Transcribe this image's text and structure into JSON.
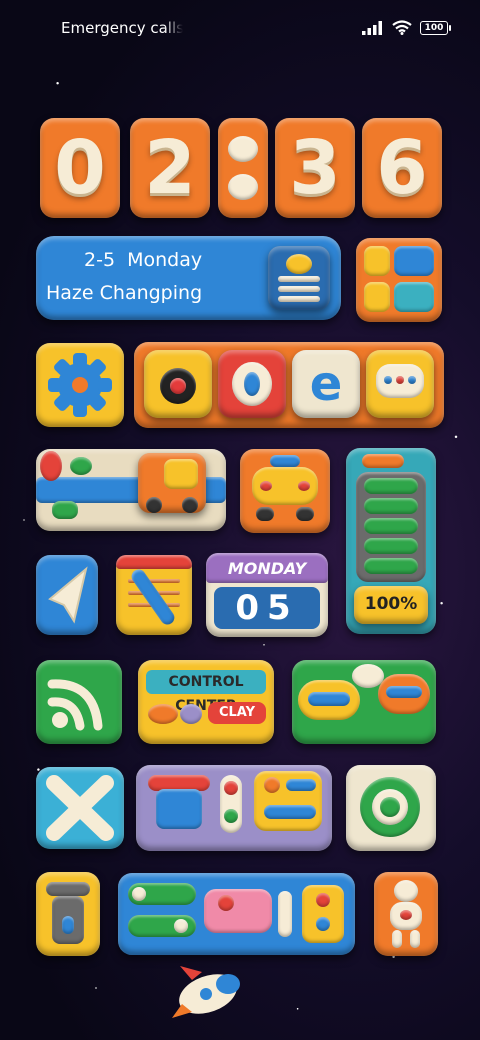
{
  "status_bar": {
    "carrier_text": "Emergency calls only",
    "battery_level": "100",
    "signal_icon": "signal-bars-icon",
    "wifi_icon": "wifi-icon"
  },
  "clock": {
    "digits": [
      "0",
      "2",
      ":",
      "3",
      "6"
    ]
  },
  "date_widget": {
    "date_text": "2-5  Monday",
    "weather_location": "Haze Changping",
    "weather_icon": "sun-haze-icon"
  },
  "calendar_widget": {
    "weekday": "MONDAY",
    "day": "05"
  },
  "battery_widget": {
    "percent": "100%",
    "level": 1.0
  },
  "control_center_widget": {
    "title": "CONTROL CENTER",
    "subtitle": "CLAY"
  },
  "icons": [
    "settings-icon",
    "camera-icon",
    "opera-browser-icon",
    "browser-e-icon",
    "messages-icon",
    "maps-icon",
    "truck-icon",
    "taxi-icon",
    "telegram-icon",
    "notes-pen-icon",
    "rss-icon",
    "chat-bubbles-icon",
    "x-icon",
    "toggles-widget-icon",
    "whatsapp-icon",
    "flashlight-icon",
    "quick-toggles-icon",
    "figure-icon",
    "rocket-icon"
  ],
  "colors": {
    "orange": "#f07a2a",
    "blue": "#2f86d6",
    "yellow": "#f7c22a",
    "green": "#2fa64a",
    "teal": "#36a8b8",
    "cream": "#f6ecd6"
  }
}
